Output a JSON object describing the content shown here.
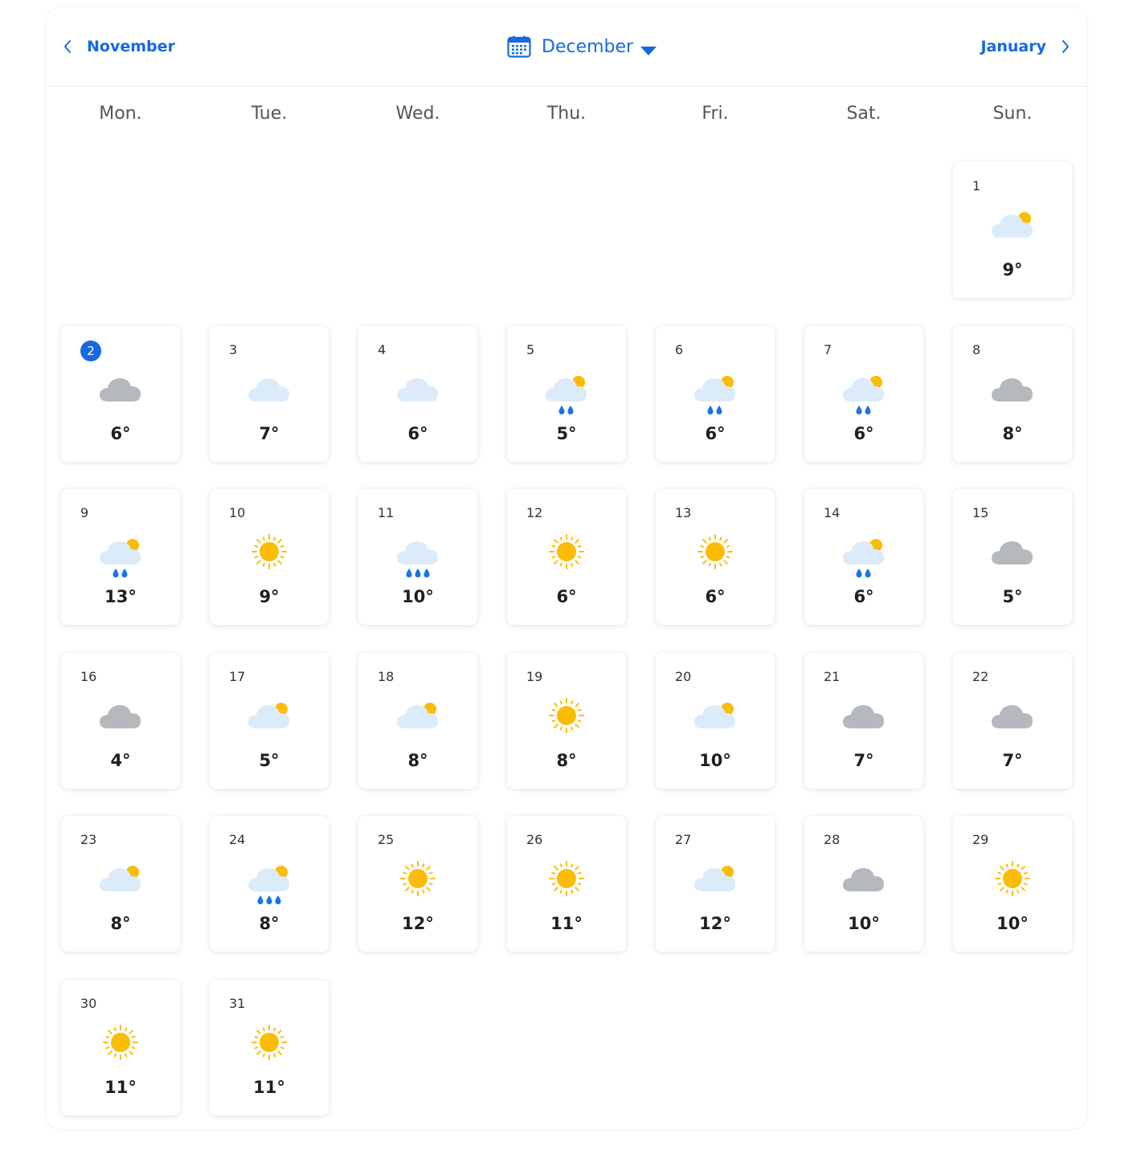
{
  "nav": {
    "prev_label": "November",
    "current_label": "December",
    "next_label": "January"
  },
  "weekdays": [
    "Mon.",
    "Tue.",
    "Wed.",
    "Thu.",
    "Fri.",
    "Sat.",
    "Sun."
  ],
  "today": 2,
  "start_weekday_index": 6,
  "colors": {
    "accent": "#1769e0",
    "sun": "#fbbc04",
    "cloud_light": "#dcebfa",
    "cloud_gray": "#b5b9bd",
    "rain": "#1a73e8"
  },
  "days": [
    {
      "day": "1",
      "icon": "partly-cloudy-icon",
      "temp": "9°"
    },
    {
      "day": "2",
      "icon": "cloudy-icon",
      "temp": "6°"
    },
    {
      "day": "3",
      "icon": "light-cloud-icon",
      "temp": "7°"
    },
    {
      "day": "4",
      "icon": "light-cloud-icon",
      "temp": "6°"
    },
    {
      "day": "5",
      "icon": "rain-sun-icon",
      "temp": "5°"
    },
    {
      "day": "6",
      "icon": "rain-sun-icon",
      "temp": "6°"
    },
    {
      "day": "7",
      "icon": "rain-sun-icon",
      "temp": "6°"
    },
    {
      "day": "8",
      "icon": "cloudy-icon",
      "temp": "8°"
    },
    {
      "day": "9",
      "icon": "rain-sun-icon",
      "temp": "13°"
    },
    {
      "day": "10",
      "icon": "sunny-icon",
      "temp": "9°"
    },
    {
      "day": "11",
      "icon": "heavy-rain-icon",
      "temp": "10°"
    },
    {
      "day": "12",
      "icon": "sunny-icon",
      "temp": "6°"
    },
    {
      "day": "13",
      "icon": "sunny-icon",
      "temp": "6°"
    },
    {
      "day": "14",
      "icon": "rain-sun-icon",
      "temp": "6°"
    },
    {
      "day": "15",
      "icon": "cloudy-icon",
      "temp": "5°"
    },
    {
      "day": "16",
      "icon": "cloudy-icon",
      "temp": "4°"
    },
    {
      "day": "17",
      "icon": "partly-cloudy-icon",
      "temp": "5°"
    },
    {
      "day": "18",
      "icon": "partly-cloudy-icon",
      "temp": "8°"
    },
    {
      "day": "19",
      "icon": "sunny-icon",
      "temp": "8°"
    },
    {
      "day": "20",
      "icon": "partly-cloudy-icon",
      "temp": "10°"
    },
    {
      "day": "21",
      "icon": "cloudy-icon",
      "temp": "7°"
    },
    {
      "day": "22",
      "icon": "cloudy-icon",
      "temp": "7°"
    },
    {
      "day": "23",
      "icon": "partly-cloudy-icon",
      "temp": "8°"
    },
    {
      "day": "24",
      "icon": "heavy-rain-sun-icon",
      "temp": "8°"
    },
    {
      "day": "25",
      "icon": "sunny-icon",
      "temp": "12°"
    },
    {
      "day": "26",
      "icon": "sunny-icon",
      "temp": "11°"
    },
    {
      "day": "27",
      "icon": "partly-cloudy-icon",
      "temp": "12°"
    },
    {
      "day": "28",
      "icon": "cloudy-icon",
      "temp": "10°"
    },
    {
      "day": "29",
      "icon": "sunny-icon",
      "temp": "10°"
    },
    {
      "day": "30",
      "icon": "sunny-icon",
      "temp": "11°"
    },
    {
      "day": "31",
      "icon": "sunny-icon",
      "temp": "11°"
    }
  ]
}
